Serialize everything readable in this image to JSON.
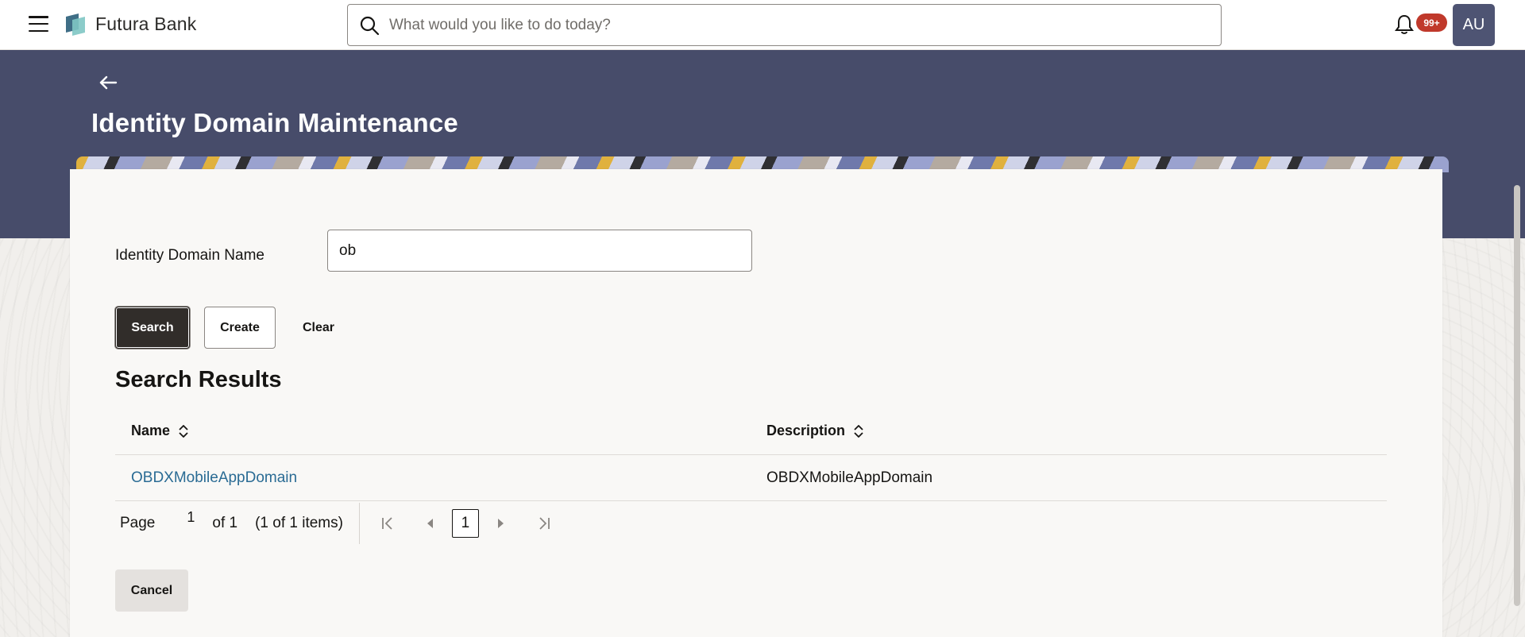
{
  "header": {
    "brand": "Futura Bank",
    "search_placeholder": "What would you like to do today?",
    "notification_count": "99+",
    "avatar_initials": "AU"
  },
  "page": {
    "title": "Identity Domain Maintenance"
  },
  "form": {
    "field_label": "Identity Domain Name",
    "field_value": "ob",
    "search_label": "Search",
    "create_label": "Create",
    "clear_label": "Clear"
  },
  "results": {
    "title": "Search Results",
    "columns": [
      "Name",
      "Description"
    ],
    "rows": [
      {
        "name": "OBDXMobileAppDomain",
        "description": "OBDXMobileAppDomain"
      }
    ]
  },
  "pagination": {
    "page_label": "Page",
    "current_page": "1",
    "of_label": "of 1",
    "items_label": "(1 of 1 items)",
    "page_button": "1"
  },
  "footer": {
    "cancel_label": "Cancel"
  },
  "colors": {
    "banner": "#474c6a",
    "primary_button": "#312d2a",
    "link": "#2a6b94",
    "badge": "#c0392b",
    "avatar": "#4e5473"
  }
}
